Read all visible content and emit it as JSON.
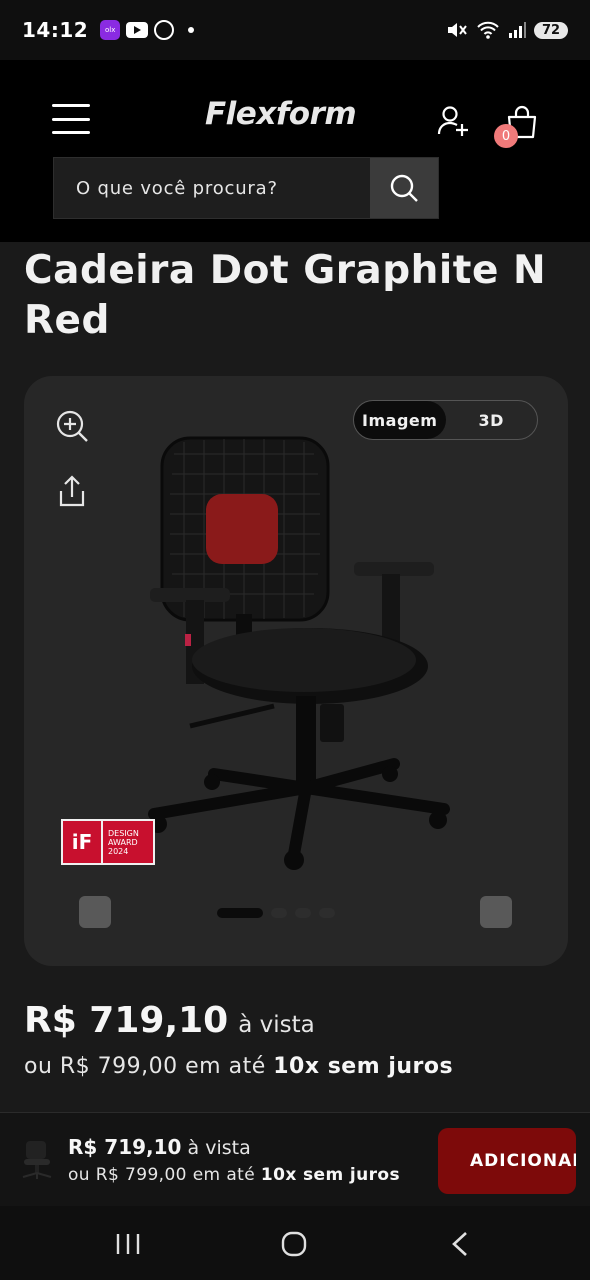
{
  "status_bar": {
    "time": "14:12",
    "apps": [
      "olx-icon",
      "youtube-icon",
      "whatsapp-icon"
    ],
    "olx_label": "olx",
    "battery": "72"
  },
  "header": {
    "logo": "Flexform",
    "cart_count": "0",
    "search_placeholder": "O que você procura?"
  },
  "product": {
    "title": "Cadeira Dot Graphite N Red",
    "view_tabs": [
      "Imagem",
      "3D"
    ],
    "active_view": "Imagem",
    "award": {
      "logo": "iF",
      "line1": "DESIGN",
      "line2": "AWARD",
      "line3": "2024"
    },
    "gallery_dots": 4,
    "price": "R$ 719,10",
    "price_suffix": "à vista",
    "installments_prefix": "ou R$ 799,00 em até",
    "installments_bold": "10x sem juros"
  },
  "sticky_bar": {
    "price": "R$ 719,10",
    "price_suffix": "à vista",
    "installments_prefix": "ou R$ 799,00 em até",
    "installments_bold": "10x sem juros",
    "add_label": "ADICIONAR"
  },
  "colors": {
    "accent_red": "#7d0a0a",
    "badge_pink": "#f07a7a",
    "background": "#1a1a1a"
  }
}
